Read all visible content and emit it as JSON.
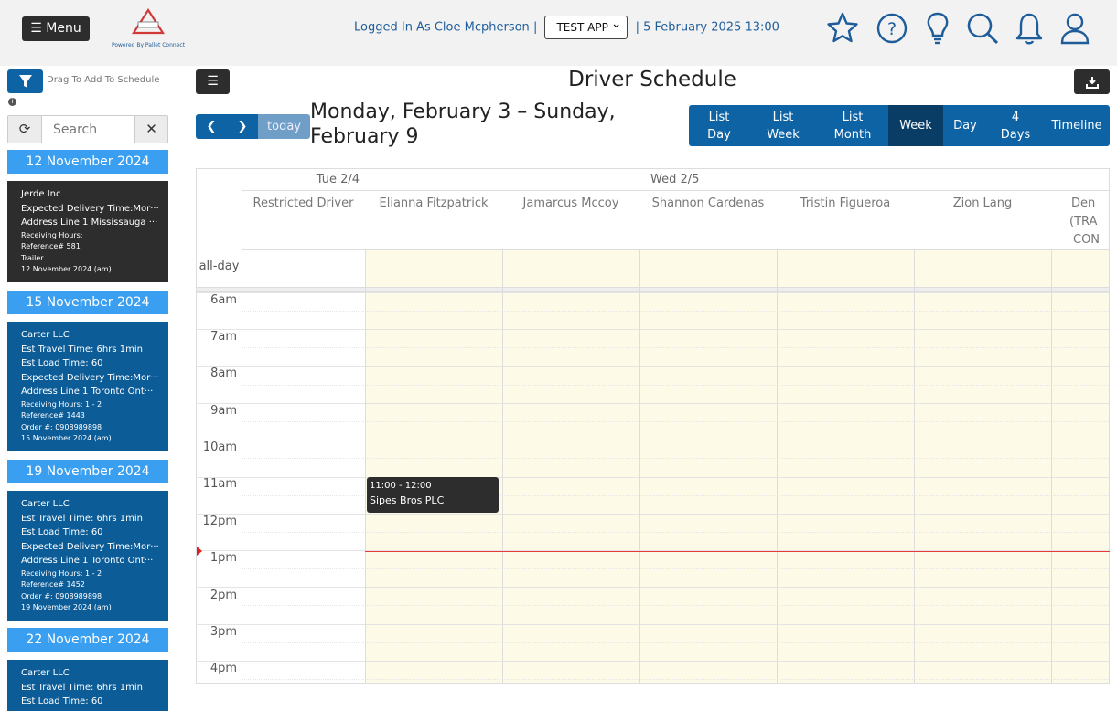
{
  "app": {
    "menu_label": "Menu",
    "logo_text": "PALLET CONNECT TEST",
    "powered_by": "Powered By Pallet Connect",
    "logged_in": "Logged In As Cloe Mcpherson",
    "app_selected": "TEST APP",
    "datetime": "5 February 2025 13:00",
    "icons": [
      "star-icon",
      "help-icon",
      "lightbulb-icon",
      "search-icon",
      "bell-icon",
      "user-icon"
    ],
    "colors": {
      "primary": "#0e63a5",
      "dark": "#2d2d2d",
      "accent": "#3a9ff0",
      "now": "#e53b3b",
      "today_bg": "#fdfbe8"
    }
  },
  "sidebar": {
    "drag_text": "Drag To Add To Schedule",
    "search_placeholder": "Search",
    "groups": [
      {
        "date": "12 November 2024",
        "lines": [
          "Jerde Inc",
          "Expected Delivery Time:Mor···",
          "Address Line 1 Mississauga ···"
        ],
        "small": [
          "Receiving Hours:",
          "Reference# 581",
          "Trailer",
          "12 November 2024 (am)"
        ]
      },
      {
        "date": "15 November 2024",
        "lines": [
          "Carter LLC",
          "Est Travel Time: 6hrs 1min",
          "Est Load Time: 60",
          "Expected Delivery Time:Mor···",
          "Address Line 1 Toronto Ont···"
        ],
        "small": [
          "Receiving Hours: 1 - 2",
          "Reference# 1443",
          "Order #: 0908989898",
          "15 November 2024 (am)"
        ]
      },
      {
        "date": "19 November 2024",
        "lines": [
          "Carter LLC",
          "Est Travel Time: 6hrs 1min",
          "Est Load Time: 60",
          "Expected Delivery Time:Mor···",
          "Address Line 1 Toronto Ont···"
        ],
        "small": [
          "Receiving Hours: 1 - 2",
          "Reference# 1452",
          "Order #: 0908989898",
          "19 November 2024 (am)"
        ]
      },
      {
        "date": "22 November 2024",
        "lines": [
          "Carter LLC",
          "Est Travel Time: 6hrs 1min",
          "Est Load Time: 60"
        ],
        "small": []
      }
    ]
  },
  "schedule": {
    "title": "Driver Schedule",
    "today_label": "today",
    "range_line1": "Monday, February 3 – Sunday,",
    "range_line2": "February 9",
    "views": [
      {
        "l1": "List",
        "l2": "Day"
      },
      {
        "l1": "List",
        "l2": "Week"
      },
      {
        "l1": "List",
        "l2": "Month"
      },
      {
        "l1": "Week",
        "l2": ""
      },
      {
        "l1": "Day",
        "l2": ""
      },
      {
        "l1": "4",
        "l2": "Days"
      },
      {
        "l1": "Timeline",
        "l2": ""
      }
    ],
    "active_view": "Week",
    "days": [
      "Tue 2/4",
      "Wed 2/5"
    ],
    "resources": [
      "Restricted Driver",
      "Elianna Fitzpatrick",
      "Jamarcus Mccoy",
      "Shannon Cardenas",
      "Tristin Figueroa",
      "Zion Lang",
      "Den",
      "(TRA",
      "CON"
    ],
    "allday_label": "all-day",
    "hours": [
      "6am",
      "7am",
      "8am",
      "9am",
      "10am",
      "11am",
      "12pm",
      "1pm",
      "2pm",
      "3pm",
      "4pm"
    ],
    "event": {
      "time": "11:00 - 12:00",
      "name": "Sipes Bros PLC"
    }
  }
}
